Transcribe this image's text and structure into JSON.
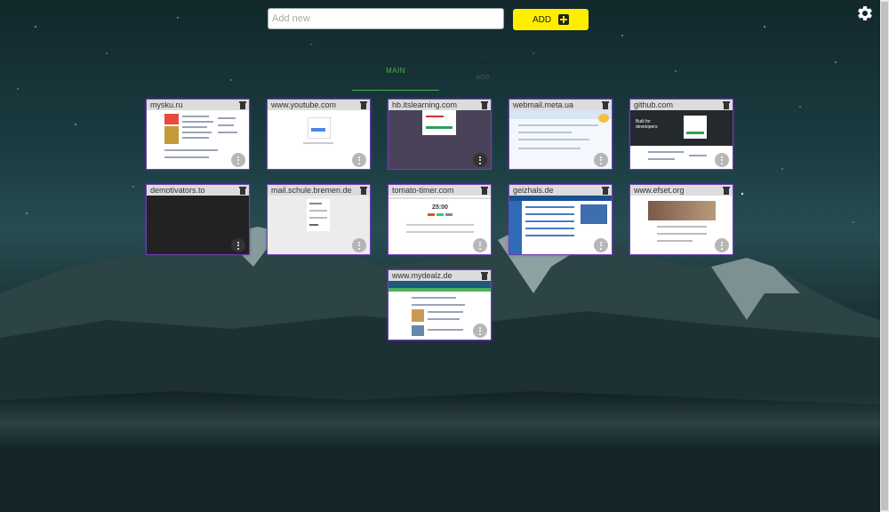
{
  "top": {
    "input_placeholder": "Add new",
    "add_button_label": "ADD",
    "settings_icon": "gear-icon"
  },
  "tabs": {
    "main_label": "MAIN",
    "add_label": "ADD"
  },
  "tiles": [
    {
      "title": "mysku.ru"
    },
    {
      "title": "www.youtube.com"
    },
    {
      "title": "hb.itslearning.com"
    },
    {
      "title": "webmail.meta.ua"
    },
    {
      "title": "github.com"
    },
    {
      "title": "demotivators.to"
    },
    {
      "title": "mail.schule.bremen.de"
    },
    {
      "title": "tomato-timer.com"
    },
    {
      "title": "geizhals.de"
    },
    {
      "title": "www.efset.org"
    },
    {
      "title": "www.mydealz.de"
    }
  ],
  "thumbs": {
    "github_heading": "Built for developers",
    "tomato_time": "25:00"
  },
  "colors": {
    "accent_yellow": "#ffee00",
    "tab_green": "#4caf50",
    "tile_border": "#6f3fb8"
  }
}
